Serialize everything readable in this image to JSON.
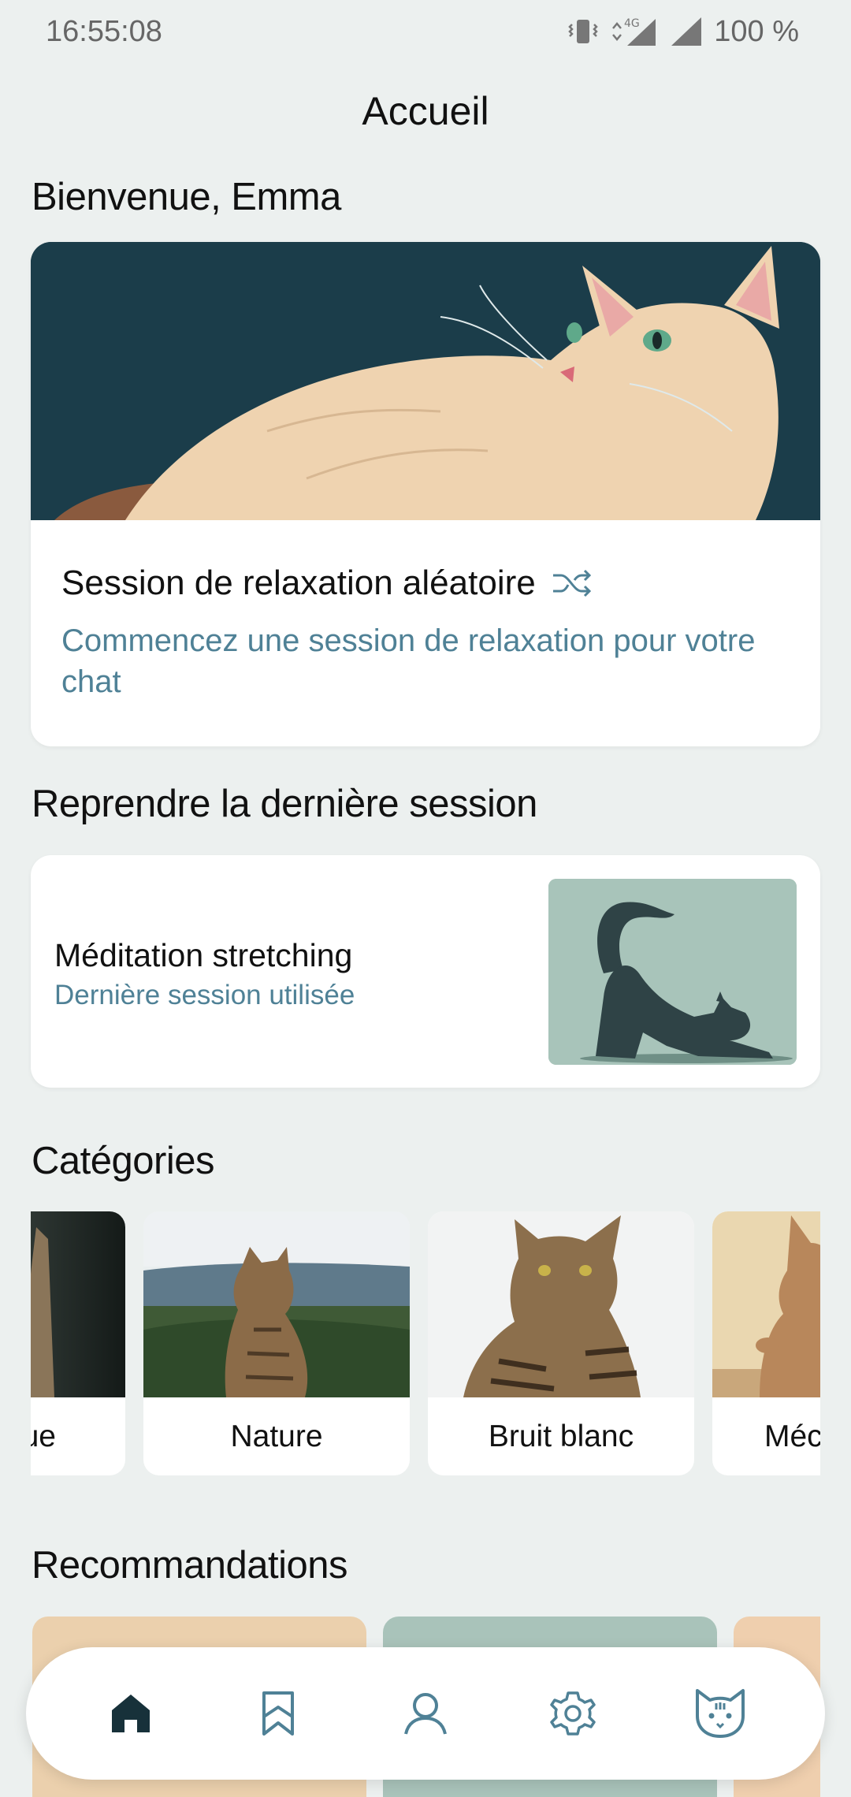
{
  "status_bar": {
    "time": "16:55:08",
    "battery": "100 %",
    "network": "4G"
  },
  "header": {
    "title": "Accueil"
  },
  "welcome": {
    "greeting": "Bienvenue, Emma"
  },
  "hero": {
    "title": "Session de relaxation aléatoire",
    "subtitle": "Commencez une session de relaxation pour votre chat",
    "icon": "shuffle-icon"
  },
  "resume": {
    "section_title": "Reprendre la dernière session",
    "session_name": "Méditation stretching",
    "session_sub": "Dernière session utilisée"
  },
  "categories": {
    "section_title": "Catégories",
    "items": [
      {
        "label": "ue"
      },
      {
        "label": "Nature"
      },
      {
        "label": "Bruit blanc"
      },
      {
        "label": "Méc"
      }
    ]
  },
  "recommendations": {
    "section_title": "Recommandations"
  },
  "bottom_nav": {
    "items": [
      "home-icon",
      "bookmark-icon",
      "profile-icon",
      "settings-icon",
      "cat-icon"
    ]
  },
  "colors": {
    "accent": "#4f8196",
    "background": "#ecf0ef",
    "hero_bg": "#1b3d4a"
  }
}
